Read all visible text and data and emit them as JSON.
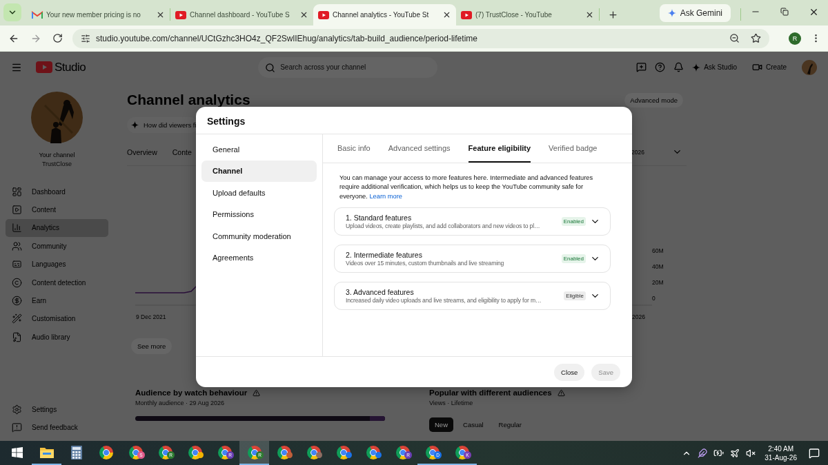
{
  "browser": {
    "tabs": [
      {
        "title": "Your new member pricing is no",
        "kind": "gmail",
        "selected": false
      },
      {
        "title": "Channel dashboard - YouTube S",
        "kind": "youtube",
        "selected": false
      },
      {
        "title": "Channel analytics - YouTube St",
        "kind": "youtube",
        "selected": true
      },
      {
        "title": "(7) TrustClose - YouTube",
        "kind": "youtube",
        "selected": false
      }
    ],
    "gemini": "Ask Gemini",
    "url": "studio.youtube.com/channel/UCtGzhc3HO4z_QF2SwlIEhug/analytics/tab-build_audience/period-lifetime",
    "profile": "R"
  },
  "studio": {
    "logo": "Studio",
    "search_placeholder": "Search across your channel",
    "ask": "Ask Studio",
    "create": "Create",
    "channel": {
      "label": "Your channel",
      "name": "TrustClose"
    },
    "nav": [
      {
        "label": "Dashboard",
        "selected": false
      },
      {
        "label": "Content",
        "selected": false
      },
      {
        "label": "Analytics",
        "selected": true
      },
      {
        "label": "Community",
        "selected": false
      },
      {
        "label": "Languages",
        "selected": false
      },
      {
        "label": "Content detection",
        "selected": false
      },
      {
        "label": "Earn",
        "selected": false
      },
      {
        "label": "Customisation",
        "selected": false
      },
      {
        "label": "Audio library",
        "selected": false
      }
    ],
    "footer_nav": [
      "Settings",
      "Send feedback"
    ],
    "title": "Channel analytics",
    "advanced_mode": "Advanced mode",
    "prompt": "How did viewers fi",
    "tabs": [
      "Overview",
      "Conte"
    ],
    "period": "2026",
    "y_labels": [
      "60M",
      "40M",
      "20M",
      "0"
    ],
    "x_labels": [
      "9 Dec 2021",
      "2026"
    ],
    "see_more": "See more",
    "audience": {
      "title": "Audience by watch behaviour",
      "subtitle": "Monthly audience · 29 Aug 2026"
    },
    "popular": {
      "title": "Popular with different audiences",
      "subtitle": "Views · Lifetime",
      "chips": [
        {
          "label": "New",
          "selected": true
        },
        {
          "label": "Casual",
          "selected": false
        },
        {
          "label": "Regular",
          "selected": false
        }
      ]
    }
  },
  "dialog": {
    "title": "Settings",
    "nav": [
      {
        "label": "General",
        "selected": false
      },
      {
        "label": "Channel",
        "selected": true
      },
      {
        "label": "Upload defaults",
        "selected": false
      },
      {
        "label": "Permissions",
        "selected": false
      },
      {
        "label": "Community moderation",
        "selected": false
      },
      {
        "label": "Agreements",
        "selected": false
      }
    ],
    "tabs": [
      {
        "label": "Basic info",
        "selected": false
      },
      {
        "label": "Advanced settings",
        "selected": false
      },
      {
        "label": "Feature eligibility",
        "selected": true
      },
      {
        "label": "Verified badge",
        "selected": false
      }
    ],
    "intro": "You can manage your access to more features here. Intermediate and advanced features require additional verification, which helps us to keep the YouTube community safe for everyone.",
    "learn_more": "Learn more",
    "features": [
      {
        "title": "1. Standard features",
        "description": "Upload videos, create playlists, and add collaborators and new videos to pl…",
        "badge": {
          "text": "Enabled",
          "kind": "enabled"
        }
      },
      {
        "title": "2. Intermediate features",
        "description": "Videos over 15 minutes, custom thumbnails and live streaming",
        "badge": {
          "text": "Enabled",
          "kind": "enabled"
        }
      },
      {
        "title": "3. Advanced features",
        "description": "Increased daily video uploads and live streams, and eligibility to apply for m…",
        "badge": {
          "text": "Eligible",
          "kind": "eligible"
        }
      }
    ],
    "close": "Close",
    "save": {
      "label": "Save",
      "disabled": true
    }
  },
  "taskbar": {
    "apps": [
      {
        "kind": "explorer",
        "selected": false,
        "running": true
      },
      {
        "kind": "calculator",
        "selected": false,
        "running": false
      },
      {
        "kind": "chrome",
        "selected": false,
        "running": false
      },
      {
        "kind": "chrome",
        "selected": false,
        "running": false,
        "badge": "S",
        "color": "#e05a8a"
      },
      {
        "kind": "chrome",
        "selected": false,
        "running": false,
        "badge": "R",
        "color": "#2e7d32"
      },
      {
        "kind": "chrome",
        "selected": false,
        "running": false,
        "color": "#f2b400"
      },
      {
        "kind": "chrome",
        "selected": false,
        "running": false,
        "badge": "R",
        "color": "#6a3fb5"
      },
      {
        "kind": "chrome",
        "selected": true,
        "running": true,
        "badge": "R",
        "color": "#2e7d32"
      },
      {
        "kind": "chrome",
        "selected": false,
        "running": false,
        "color": "#c0603a"
      },
      {
        "kind": "chrome",
        "selected": false,
        "running": false,
        "color": "#8d6e63"
      },
      {
        "kind": "chrome",
        "selected": false,
        "running": false,
        "color": "#1a73e8"
      },
      {
        "kind": "chrome",
        "selected": false,
        "running": false,
        "color": "#1a73e8"
      },
      {
        "kind": "chrome",
        "selected": false,
        "running": false,
        "badge": "R",
        "color": "#6a3fb5"
      },
      {
        "kind": "chrome",
        "selected": false,
        "running": true,
        "badge": "D",
        "color": "#1a73e8"
      },
      {
        "kind": "chrome",
        "selected": false,
        "running": true,
        "badge": "K",
        "color": "#7b3fb5"
      }
    ],
    "time": "2:40 AM",
    "date": "31-Aug-26"
  }
}
